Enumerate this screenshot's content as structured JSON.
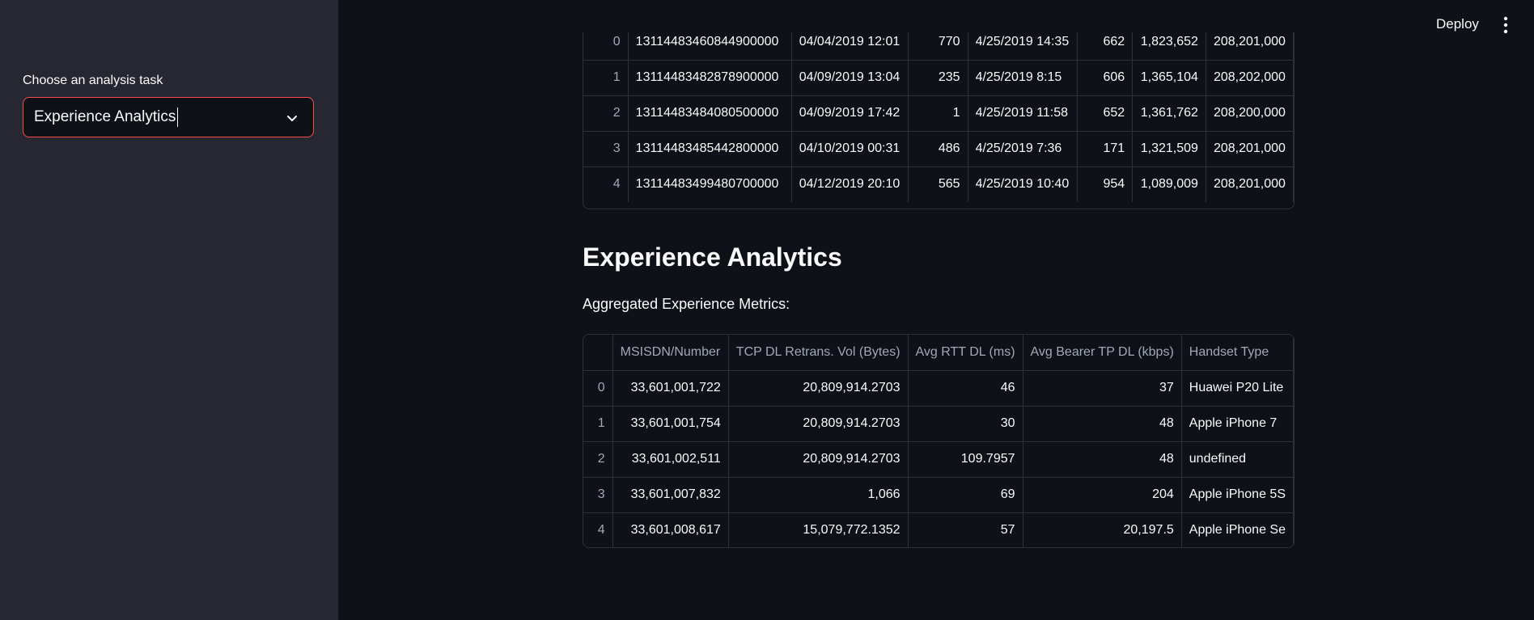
{
  "sidebar": {
    "label": "Choose an analysis task",
    "select_value": "Experience Analytics"
  },
  "header": {
    "deploy_label": "Deploy",
    "menu_icon": "vertical-dots-icon"
  },
  "top_table": {
    "rows": [
      {
        "idx": "0",
        "c1": "13114483460844900000",
        "c2": "04/04/2019 12:01",
        "c3": "770",
        "c4": "4/25/2019 14:35",
        "c5": "662",
        "c6": "1,823,652",
        "c7": "208,201,000"
      },
      {
        "idx": "1",
        "c1": "13114483482878900000",
        "c2": "04/09/2019 13:04",
        "c3": "235",
        "c4": "4/25/2019 8:15",
        "c5": "606",
        "c6": "1,365,104",
        "c7": "208,202,000"
      },
      {
        "idx": "2",
        "c1": "13114483484080500000",
        "c2": "04/09/2019 17:42",
        "c3": "1",
        "c4": "4/25/2019 11:58",
        "c5": "652",
        "c6": "1,361,762",
        "c7": "208,200,000"
      },
      {
        "idx": "3",
        "c1": "13114483485442800000",
        "c2": "04/10/2019 00:31",
        "c3": "486",
        "c4": "4/25/2019 7:36",
        "c5": "171",
        "c6": "1,321,509",
        "c7": "208,201,000"
      },
      {
        "idx": "4",
        "c1": "13114483499480700000",
        "c2": "04/12/2019 20:10",
        "c3": "565",
        "c4": "4/25/2019 10:40",
        "c5": "954",
        "c6": "1,089,009",
        "c7": "208,201,000"
      }
    ]
  },
  "section": {
    "title": "Experience Analytics",
    "subtitle": "Aggregated Experience Metrics:"
  },
  "metrics_table": {
    "headers": [
      "",
      "MSISDN/Number",
      "TCP DL Retrans. Vol (Bytes)",
      "Avg RTT DL (ms)",
      "Avg Bearer TP DL (kbps)",
      "Handset Type"
    ],
    "rows": [
      {
        "idx": "0",
        "msisdn": "33,601,001,722",
        "tcp": "20,809,914.2703",
        "rtt": "46",
        "tp": "37",
        "handset": "Huawei P20 Lite"
      },
      {
        "idx": "1",
        "msisdn": "33,601,001,754",
        "tcp": "20,809,914.2703",
        "rtt": "30",
        "tp": "48",
        "handset": "Apple iPhone 7"
      },
      {
        "idx": "2",
        "msisdn": "33,601,002,511",
        "tcp": "20,809,914.2703",
        "rtt": "109.7957",
        "tp": "48",
        "handset": "undefined"
      },
      {
        "idx": "3",
        "msisdn": "33,601,007,832",
        "tcp": "1,066",
        "rtt": "69",
        "tp": "204",
        "handset": "Apple iPhone 5S"
      },
      {
        "idx": "4",
        "msisdn": "33,601,008,617",
        "tcp": "15,079,772.1352",
        "rtt": "57",
        "tp": "20,197.5",
        "handset": "Apple iPhone Se"
      }
    ]
  }
}
